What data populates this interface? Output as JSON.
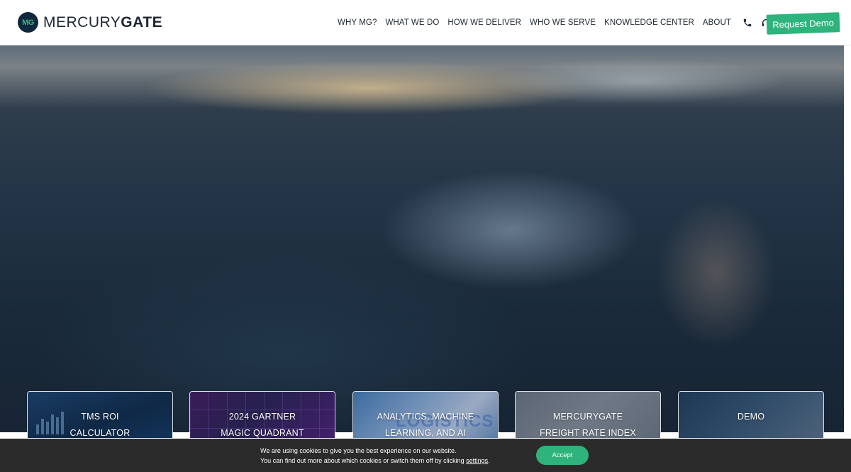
{
  "brand": {
    "badge": "MG",
    "name_thin": "MERCURY",
    "name_bold": "GATE"
  },
  "nav": {
    "items": [
      {
        "label": "WHY MG?"
      },
      {
        "label": "WHAT WE DO"
      },
      {
        "label": "HOW WE DELIVER"
      },
      {
        "label": "WHO WE SERVE"
      },
      {
        "label": "KNOWLEDGE CENTER"
      },
      {
        "label": "ABOUT"
      }
    ],
    "icons": [
      "phone-icon",
      "headset-icon",
      "users-icon",
      "search-icon"
    ],
    "cta_label": "Request Demo"
  },
  "cards": [
    {
      "line1": "TMS ROI",
      "line2": "CALCULATOR"
    },
    {
      "line1": "2024 GARTNER",
      "line2": "MAGIC QUADRANT"
    },
    {
      "line1": "ANALYTICS, MACHINE",
      "line2": "LEARNING, AND AI",
      "watermark": "LOGISTICS"
    },
    {
      "line1": "MERCURYGATE",
      "line2": "FREIGHT RATE INDEX"
    },
    {
      "line1": "DEMO",
      "line2": ""
    }
  ],
  "cookie": {
    "line1": "We are using cookies to give you the best experience on our website.",
    "line2_prefix": "You can find out more about which cookies or switch them off by clicking ",
    "line2_link": "settings",
    "line2_suffix": ".",
    "accept_label": "Accept"
  },
  "colors": {
    "accent": "#2eb37c",
    "brand_dark": "#10283e",
    "cookie_bg": "#2b2b2b"
  }
}
